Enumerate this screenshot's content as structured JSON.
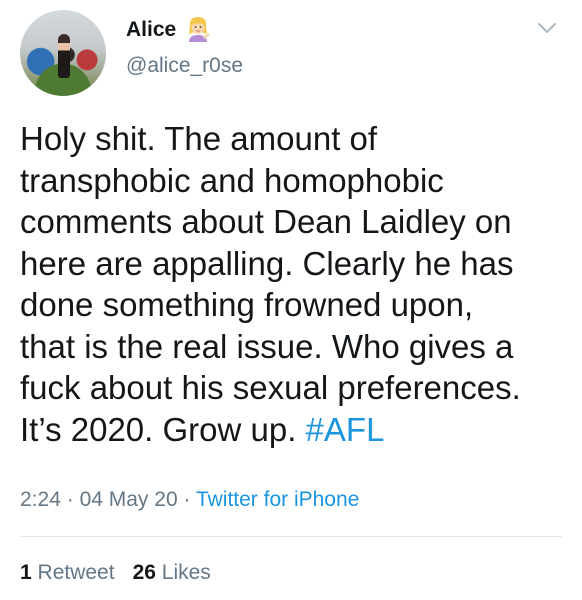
{
  "user": {
    "name": "Alice",
    "handle": "@alice_r0se",
    "emoji_icon": "woman-tipping-hand-icon"
  },
  "tweet": {
    "text": "Holy shit. The amount of\ntransphobic and homophobic\ncomments about Dean Laidley on\nhere are appalling. Clearly he has\ndone something frowned upon,\nthat is the real issue. Who gives a\nfuck about his sexual preferences.\nIt’s 2020. Grow up. ",
    "hashtag": "#AFL"
  },
  "meta": {
    "time": "2:24",
    "separator": "·",
    "date": "04 May 20",
    "source": "Twitter for iPhone"
  },
  "stats": {
    "retweet_count": "1",
    "retweet_label": "Retweet",
    "like_count": "26",
    "like_label": "Likes"
  },
  "colors": {
    "text": "#14171a",
    "secondary": "#657786",
    "link": "#1b95e0",
    "divider": "#e1e8ed"
  }
}
